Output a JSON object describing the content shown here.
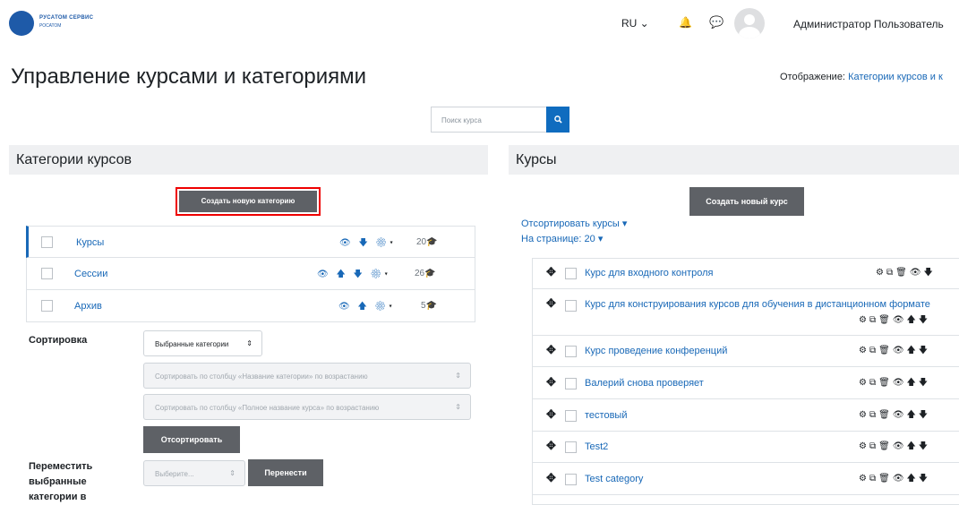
{
  "brand": {
    "name": "РУСАТОМ СЕРВИС",
    "sub": "РОСАТОМ"
  },
  "navbar": {
    "lang": "RU ⌄",
    "user_name": "Администратор Пользователь"
  },
  "page": {
    "title": "Управление курсами и категориями",
    "view_label": "Отображение:",
    "view_value": "Категории курсов и к"
  },
  "search": {
    "placeholder": "Поиск курса"
  },
  "categories": {
    "header": "Категории курсов",
    "create_button": "Создать новую категорию",
    "items": [
      {
        "name": "Курсы",
        "count": "20"
      },
      {
        "name": "Сессии",
        "count": "26"
      },
      {
        "name": "Архив",
        "count": "5"
      }
    ]
  },
  "sorting": {
    "label": "Сортировка",
    "select_scope": "Выбранные категории",
    "select_category": "Сортировать по столбцу «Название категории» по возрастанию",
    "select_course": "Сортировать по столбцу «Полное название курса» по возрастанию",
    "sort_button": "Отсортировать"
  },
  "move": {
    "label_line1": "Переместить",
    "label_line2": "выбранные",
    "label_line3": "категории в",
    "select_placeholder": "Выберите...",
    "move_button": "Перенести"
  },
  "courses": {
    "header": "Курсы",
    "create_button": "Создать новый курс",
    "sort_link": "Отсортировать курсы",
    "per_page": "На странице: 20",
    "items": [
      {
        "name": "Курс для входного контроля"
      },
      {
        "name": "Курс для конструирования курсов для обучения в дистанционном формате"
      },
      {
        "name": "Курс проведение конференций"
      },
      {
        "name": "Валерий снова проверяет"
      },
      {
        "name": "тестовый"
      },
      {
        "name": "Test2"
      },
      {
        "name": "Test category"
      }
    ]
  },
  "colors": {
    "accent": "#0f6cbf",
    "link": "#1868b7",
    "dark_button": "#5e6166",
    "highlight_border": "#ee0000"
  }
}
